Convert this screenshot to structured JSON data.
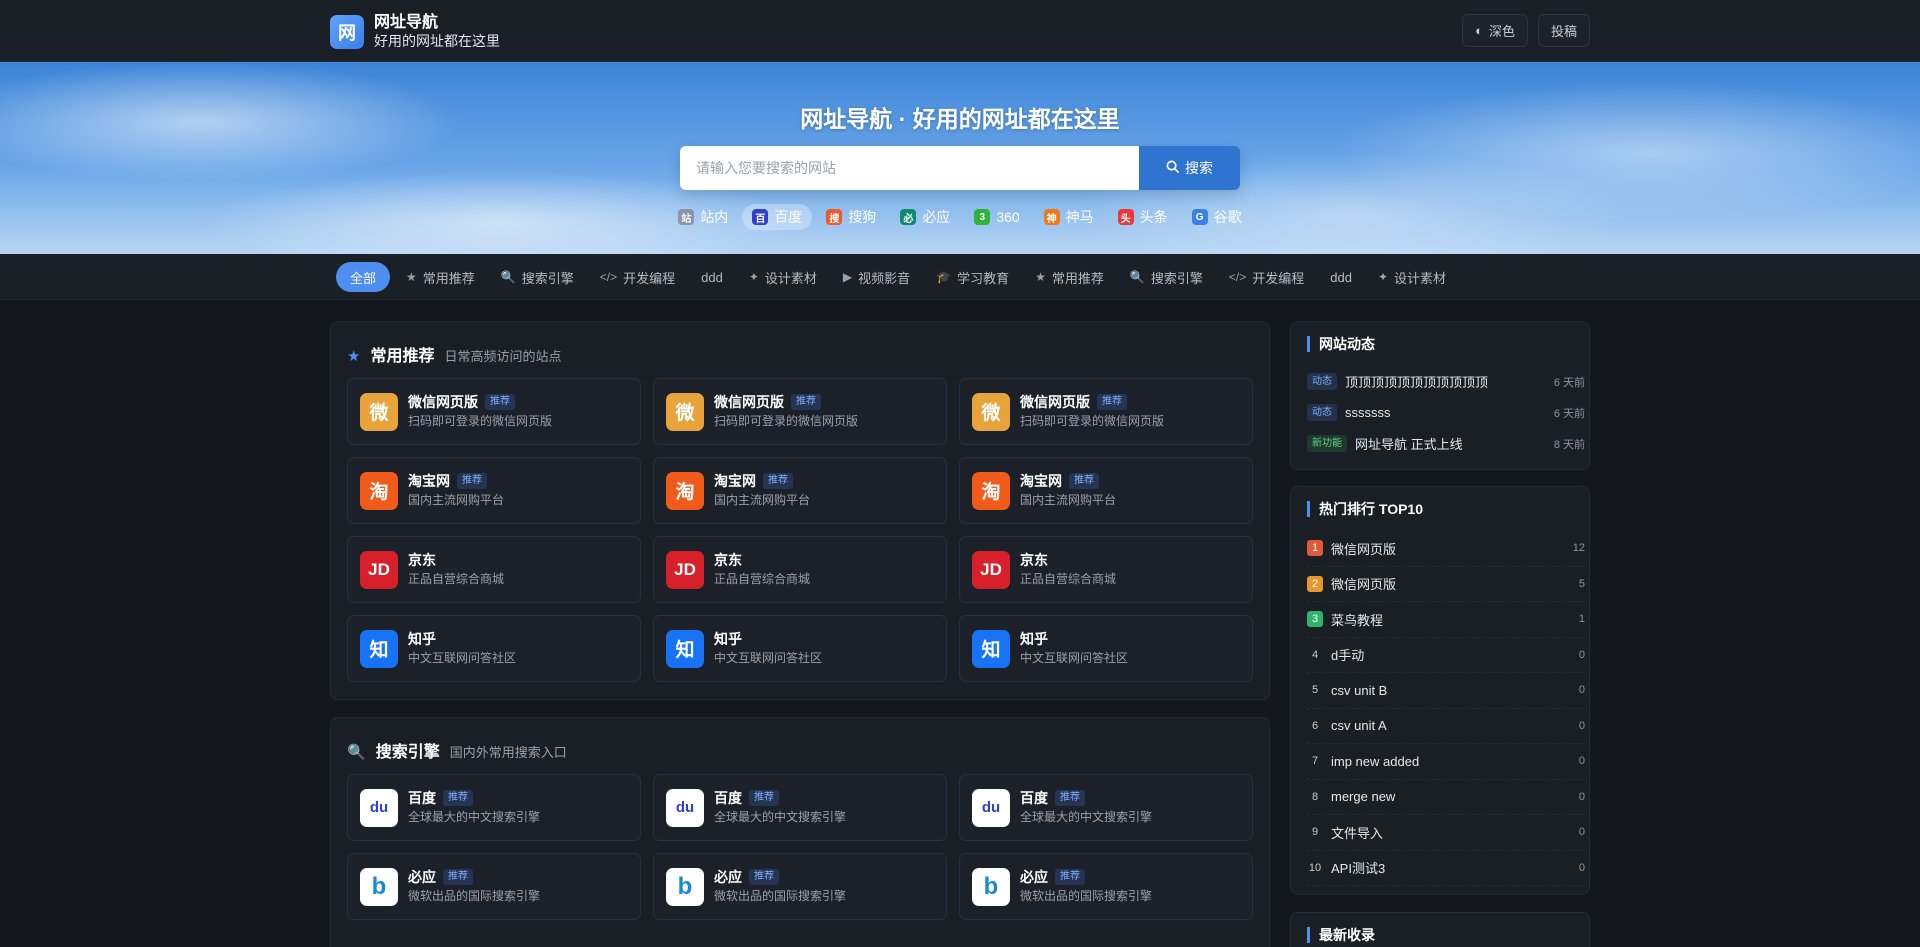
{
  "header": {
    "logo_char": "网",
    "title": "网址导航",
    "subtitle": "好用的网址都在这里",
    "theme_label": "深色",
    "submit_label": "投稿"
  },
  "hero": {
    "title": "网址导航 · 好用的网址都在这里",
    "search_placeholder": "请输入您要搜索的网站",
    "search_button": "搜索",
    "engines": [
      {
        "icon": "站",
        "label": "站内",
        "color": "#8a94a6"
      },
      {
        "icon": "百",
        "label": "百度",
        "color": "#2f3fcf"
      },
      {
        "icon": "搜",
        "label": "搜狗",
        "color": "#f05a28"
      },
      {
        "icon": "必",
        "label": "必应",
        "color": "#0e8a6e"
      },
      {
        "icon": "3",
        "label": "360",
        "color": "#2fb33a"
      },
      {
        "icon": "神",
        "label": "神马",
        "color": "#f07a1a"
      },
      {
        "icon": "头",
        "label": "头条",
        "color": "#e83a3a"
      },
      {
        "icon": "G",
        "label": "谷歌",
        "color": "#3a7ee8"
      }
    ]
  },
  "categories": [
    {
      "icon": "",
      "label": "全部"
    },
    {
      "icon": "★",
      "label": "常用推荐"
    },
    {
      "icon": "🔍",
      "label": "搜索引擎"
    },
    {
      "icon": "</>",
      "label": "开发编程"
    },
    {
      "icon": "",
      "label": "ddd"
    },
    {
      "icon": "✦",
      "label": "设计素材"
    },
    {
      "icon": "▶",
      "label": "视频影音"
    },
    {
      "icon": "🎓",
      "label": "学习教育"
    },
    {
      "icon": "★",
      "label": "常用推荐"
    },
    {
      "icon": "🔍",
      "label": "搜索引擎"
    },
    {
      "icon": "</>",
      "label": "开发编程"
    },
    {
      "icon": "",
      "label": "ddd"
    },
    {
      "icon": "✦",
      "label": "设计素材"
    }
  ],
  "sections": [
    {
      "icon": "★",
      "title": "常用推荐",
      "desc": "日常高频访问的站点",
      "sites": [
        {
          "icon": "微",
          "name": "微信网页版",
          "tag": "推荐",
          "desc": "扫码即可登录的微信网页版",
          "color": "#e8a33a"
        },
        {
          "icon": "微",
          "name": "微信网页版",
          "tag": "推荐",
          "desc": "扫码即可登录的微信网页版",
          "color": "#e8a33a"
        },
        {
          "icon": "微",
          "name": "微信网页版",
          "tag": "推荐",
          "desc": "扫码即可登录的微信网页版",
          "color": "#e8a33a"
        },
        {
          "icon": "淘",
          "name": "淘宝网",
          "tag": "推荐",
          "desc": "国内主流网购平台",
          "color": "#f05a1a"
        },
        {
          "icon": "淘",
          "name": "淘宝网",
          "tag": "推荐",
          "desc": "国内主流网购平台",
          "color": "#f05a1a"
        },
        {
          "icon": "淘",
          "name": "淘宝网",
          "tag": "推荐",
          "desc": "国内主流网购平台",
          "color": "#f05a1a"
        },
        {
          "icon": "JD",
          "name": "京东",
          "tag": "",
          "desc": "正品自营综合商城",
          "color": "#d8202a"
        },
        {
          "icon": "JD",
          "name": "京东",
          "tag": "",
          "desc": "正品自营综合商城",
          "color": "#d8202a"
        },
        {
          "icon": "JD",
          "name": "京东",
          "tag": "",
          "desc": "正品自营综合商城",
          "color": "#d8202a"
        },
        {
          "icon": "知",
          "name": "知乎",
          "tag": "",
          "desc": "中文互联网问答社区",
          "color": "#1772f6"
        },
        {
          "icon": "知",
          "name": "知乎",
          "tag": "",
          "desc": "中文互联网问答社区",
          "color": "#1772f6"
        },
        {
          "icon": "知",
          "name": "知乎",
          "tag": "",
          "desc": "中文互联网问答社区",
          "color": "#1772f6"
        }
      ]
    },
    {
      "icon": "🔍",
      "title": "搜索引擎",
      "desc": "国内外常用搜索入口",
      "sites": [
        {
          "icon": "du",
          "name": "百度",
          "tag": "推荐",
          "desc": "全球最大的中文搜索引擎",
          "color": "#ffffff"
        },
        {
          "icon": "du",
          "name": "百度",
          "tag": "推荐",
          "desc": "全球最大的中文搜索引擎",
          "color": "#ffffff"
        },
        {
          "icon": "du",
          "name": "百度",
          "tag": "推荐",
          "desc": "全球最大的中文搜索引擎",
          "color": "#ffffff"
        },
        {
          "icon": "b",
          "name": "必应",
          "tag": "推荐",
          "desc": "微软出品的国际搜索引擎",
          "color": "#ffffff"
        },
        {
          "icon": "b",
          "name": "必应",
          "tag": "推荐",
          "desc": "微软出品的国际搜索引擎",
          "color": "#ffffff"
        },
        {
          "icon": "b",
          "name": "必应",
          "tag": "推荐",
          "desc": "微软出品的国际搜索引擎",
          "color": "#ffffff"
        }
      ]
    }
  ],
  "news": {
    "title": "网站动态",
    "items": [
      {
        "badge": "动态",
        "text": "顶顶顶顶顶顶顶顶顶顶顶",
        "time": "6 天前"
      },
      {
        "badge": "动态",
        "text": "sssssss",
        "time": "6 天前"
      },
      {
        "badge": "新功能",
        "text": "网址导航 正式上线",
        "time": "8 天前"
      }
    ]
  },
  "ranking": {
    "title": "热门排行 TOP10",
    "items": [
      {
        "rank": "1",
        "name": "微信网页版",
        "count": "12"
      },
      {
        "rank": "2",
        "name": "微信网页版",
        "count": "5"
      },
      {
        "rank": "3",
        "name": "菜鸟教程",
        "count": "1"
      },
      {
        "rank": "4",
        "name": "d手动",
        "count": "0"
      },
      {
        "rank": "5",
        "name": "csv unit B",
        "count": "0"
      },
      {
        "rank": "6",
        "name": "csv unit A",
        "count": "0"
      },
      {
        "rank": "7",
        "name": "imp new added",
        "count": "0"
      },
      {
        "rank": "8",
        "name": "merge new",
        "count": "0"
      },
      {
        "rank": "9",
        "name": "文件导入",
        "count": "0"
      },
      {
        "rank": "10",
        "name": "API测试3",
        "count": "0"
      }
    ]
  },
  "latest": {
    "title": "最新收录"
  }
}
